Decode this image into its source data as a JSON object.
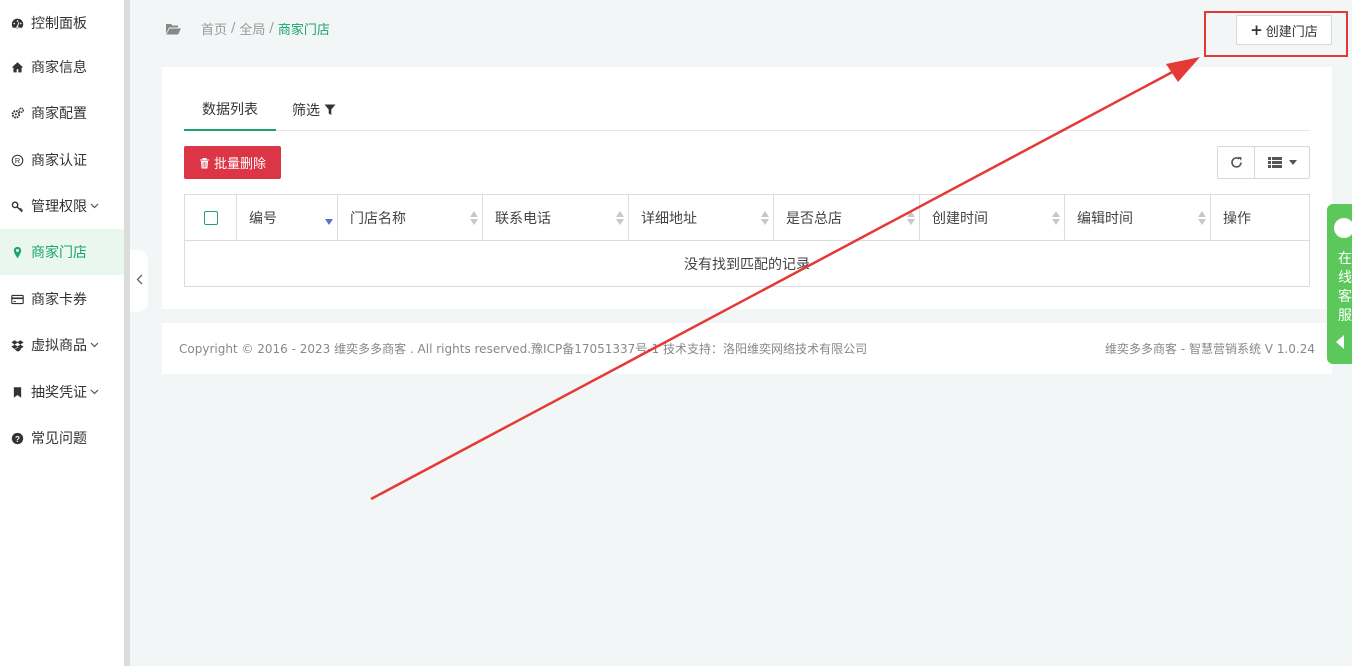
{
  "sidebar": {
    "items": [
      {
        "label": "控制面板",
        "icon": "dashboard-icon"
      },
      {
        "label": "商家信息",
        "icon": "home-icon"
      },
      {
        "label": "商家配置",
        "icon": "gears-icon"
      },
      {
        "label": "商家认证",
        "icon": "registered-icon"
      },
      {
        "label": "管理权限",
        "icon": "key-icon",
        "has_submenu": true
      },
      {
        "label": "商家门店",
        "icon": "map-marker-icon",
        "active": true
      },
      {
        "label": "商家卡券",
        "icon": "credit-card-icon"
      },
      {
        "label": "虚拟商品",
        "icon": "dropbox-icon",
        "has_submenu": true
      },
      {
        "label": "抽奖凭证",
        "icon": "bookmark-icon",
        "has_submenu": true
      },
      {
        "label": "常见问题",
        "icon": "question-circle-icon"
      }
    ]
  },
  "breadcrumb": {
    "home": "首页",
    "global": "全局",
    "current": "商家门店"
  },
  "header": {
    "create_label": "创建门店"
  },
  "tabs": {
    "list": "数据列表",
    "filter": "筛选"
  },
  "toolbar": {
    "batch_delete": "批量删除"
  },
  "table": {
    "columns": [
      "编号",
      "门店名称",
      "联系电话",
      "详细地址",
      "是否总店",
      "创建时间",
      "编辑时间",
      "操作"
    ],
    "empty_message": "没有找到匹配的记录"
  },
  "footer": {
    "copyright": "Copyright © 2016 - 2023 维奕多多商客 . All rights reserved.豫ICP备17051337号-1 技术支持：洛阳维奕网络技术有限公司",
    "version": "维奕多多商客 - 智慧营销系统 V 1.0.24"
  },
  "service": {
    "label": "在线客服"
  },
  "colors": {
    "accent": "#1aa56a",
    "danger": "#dc3545",
    "highlight": "#e53935",
    "service": "#5cc85c"
  }
}
